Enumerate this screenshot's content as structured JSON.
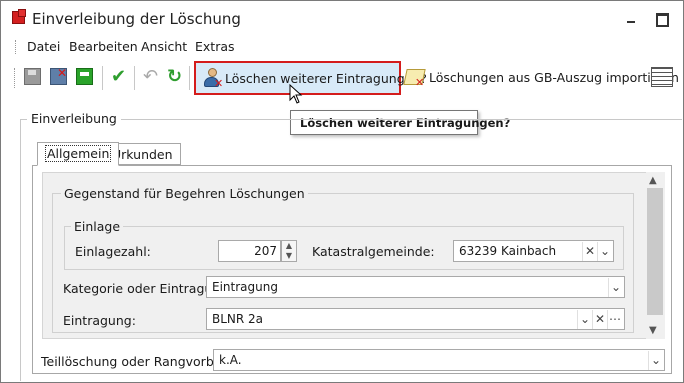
{
  "window": {
    "title": "Einverleibung der Löschung"
  },
  "menu": {
    "datei": "Datei",
    "bearbeiten": "Bearbeiten",
    "ansicht": "Ansicht",
    "extras": "Extras"
  },
  "toolbar": {
    "loeschen_label": "Löschen weiterer Eintragungen?",
    "import_label": "Löschungen aus GB-Auszug importieren",
    "icons": [
      "save-disabled-icon",
      "delete-save-icon",
      "green-box-icon",
      "checkmark-icon",
      "undo-icon",
      "refresh-icon",
      "user-delete-icon",
      "document-delete-icon",
      "grid-view-icon"
    ]
  },
  "tooltip": {
    "text": "Löschen weiterer Eintragungen?"
  },
  "einverleibung": {
    "group_label": "Einverleibung",
    "tabs": [
      {
        "label": "Allgemein",
        "active": true
      },
      {
        "label": "Urkunden",
        "active": false
      }
    ],
    "gegenstand": {
      "group_label": "Gegenstand für Begehren Löschungen",
      "einlage": {
        "group_label": "Einlage",
        "einlagezahl_label": "Einlagezahl:",
        "einlagezahl_value": "207",
        "katastralgemeinde_label": "Katastralgemeinde:",
        "katastralgemeinde_value": "63239 Kainbach"
      },
      "kategorie_label": "Kategorie oder Eintragung:",
      "kategorie_value": "Eintragung",
      "eintragung_label": "Eintragung:",
      "eintragung_value": "BLNR 2a"
    },
    "teilloeschung_label": "Teillöschung oder Rangvorbehalt:",
    "teilloeschung_value": "k.A."
  },
  "colors": {
    "highlight_border": "#d41c1c",
    "highlight_fill": "#d8eaf8"
  }
}
